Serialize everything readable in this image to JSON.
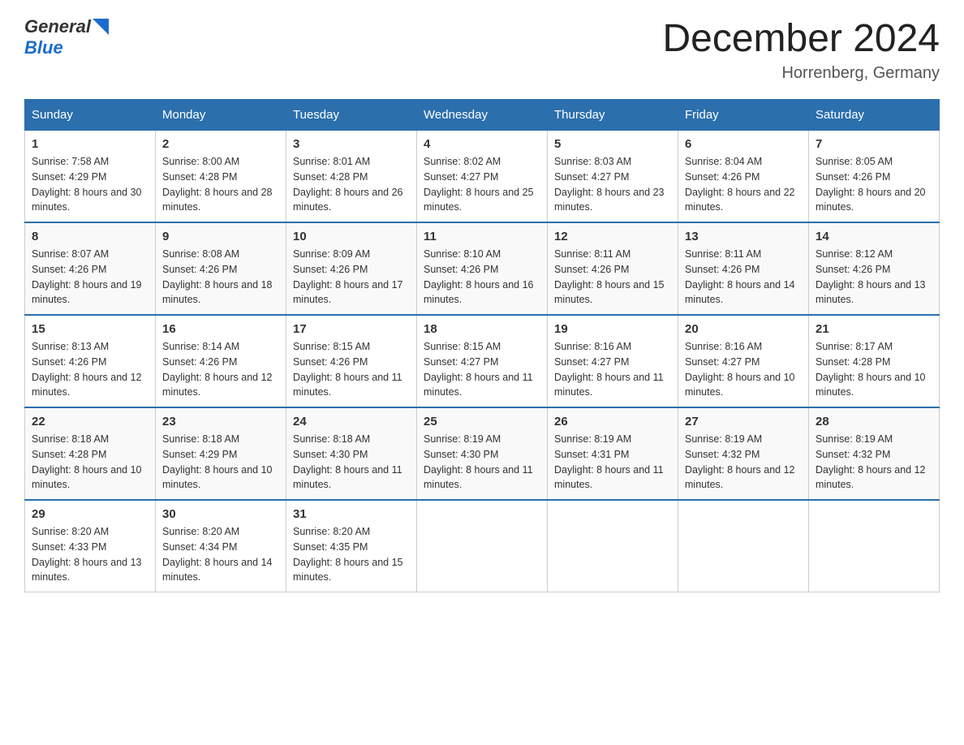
{
  "logo": {
    "general": "General",
    "blue": "Blue"
  },
  "title": "December 2024",
  "location": "Horrenberg, Germany",
  "days_header": [
    "Sunday",
    "Monday",
    "Tuesday",
    "Wednesday",
    "Thursday",
    "Friday",
    "Saturday"
  ],
  "weeks": [
    [
      {
        "day": "1",
        "sunrise": "7:58 AM",
        "sunset": "4:29 PM",
        "daylight": "8 hours and 30 minutes."
      },
      {
        "day": "2",
        "sunrise": "8:00 AM",
        "sunset": "4:28 PM",
        "daylight": "8 hours and 28 minutes."
      },
      {
        "day": "3",
        "sunrise": "8:01 AM",
        "sunset": "4:28 PM",
        "daylight": "8 hours and 26 minutes."
      },
      {
        "day": "4",
        "sunrise": "8:02 AM",
        "sunset": "4:27 PM",
        "daylight": "8 hours and 25 minutes."
      },
      {
        "day": "5",
        "sunrise": "8:03 AM",
        "sunset": "4:27 PM",
        "daylight": "8 hours and 23 minutes."
      },
      {
        "day": "6",
        "sunrise": "8:04 AM",
        "sunset": "4:26 PM",
        "daylight": "8 hours and 22 minutes."
      },
      {
        "day": "7",
        "sunrise": "8:05 AM",
        "sunset": "4:26 PM",
        "daylight": "8 hours and 20 minutes."
      }
    ],
    [
      {
        "day": "8",
        "sunrise": "8:07 AM",
        "sunset": "4:26 PM",
        "daylight": "8 hours and 19 minutes."
      },
      {
        "day": "9",
        "sunrise": "8:08 AM",
        "sunset": "4:26 PM",
        "daylight": "8 hours and 18 minutes."
      },
      {
        "day": "10",
        "sunrise": "8:09 AM",
        "sunset": "4:26 PM",
        "daylight": "8 hours and 17 minutes."
      },
      {
        "day": "11",
        "sunrise": "8:10 AM",
        "sunset": "4:26 PM",
        "daylight": "8 hours and 16 minutes."
      },
      {
        "day": "12",
        "sunrise": "8:11 AM",
        "sunset": "4:26 PM",
        "daylight": "8 hours and 15 minutes."
      },
      {
        "day": "13",
        "sunrise": "8:11 AM",
        "sunset": "4:26 PM",
        "daylight": "8 hours and 14 minutes."
      },
      {
        "day": "14",
        "sunrise": "8:12 AM",
        "sunset": "4:26 PM",
        "daylight": "8 hours and 13 minutes."
      }
    ],
    [
      {
        "day": "15",
        "sunrise": "8:13 AM",
        "sunset": "4:26 PM",
        "daylight": "8 hours and 12 minutes."
      },
      {
        "day": "16",
        "sunrise": "8:14 AM",
        "sunset": "4:26 PM",
        "daylight": "8 hours and 12 minutes."
      },
      {
        "day": "17",
        "sunrise": "8:15 AM",
        "sunset": "4:26 PM",
        "daylight": "8 hours and 11 minutes."
      },
      {
        "day": "18",
        "sunrise": "8:15 AM",
        "sunset": "4:27 PM",
        "daylight": "8 hours and 11 minutes."
      },
      {
        "day": "19",
        "sunrise": "8:16 AM",
        "sunset": "4:27 PM",
        "daylight": "8 hours and 11 minutes."
      },
      {
        "day": "20",
        "sunrise": "8:16 AM",
        "sunset": "4:27 PM",
        "daylight": "8 hours and 10 minutes."
      },
      {
        "day": "21",
        "sunrise": "8:17 AM",
        "sunset": "4:28 PM",
        "daylight": "8 hours and 10 minutes."
      }
    ],
    [
      {
        "day": "22",
        "sunrise": "8:18 AM",
        "sunset": "4:28 PM",
        "daylight": "8 hours and 10 minutes."
      },
      {
        "day": "23",
        "sunrise": "8:18 AM",
        "sunset": "4:29 PM",
        "daylight": "8 hours and 10 minutes."
      },
      {
        "day": "24",
        "sunrise": "8:18 AM",
        "sunset": "4:30 PM",
        "daylight": "8 hours and 11 minutes."
      },
      {
        "day": "25",
        "sunrise": "8:19 AM",
        "sunset": "4:30 PM",
        "daylight": "8 hours and 11 minutes."
      },
      {
        "day": "26",
        "sunrise": "8:19 AM",
        "sunset": "4:31 PM",
        "daylight": "8 hours and 11 minutes."
      },
      {
        "day": "27",
        "sunrise": "8:19 AM",
        "sunset": "4:32 PM",
        "daylight": "8 hours and 12 minutes."
      },
      {
        "day": "28",
        "sunrise": "8:19 AM",
        "sunset": "4:32 PM",
        "daylight": "8 hours and 12 minutes."
      }
    ],
    [
      {
        "day": "29",
        "sunrise": "8:20 AM",
        "sunset": "4:33 PM",
        "daylight": "8 hours and 13 minutes."
      },
      {
        "day": "30",
        "sunrise": "8:20 AM",
        "sunset": "4:34 PM",
        "daylight": "8 hours and 14 minutes."
      },
      {
        "day": "31",
        "sunrise": "8:20 AM",
        "sunset": "4:35 PM",
        "daylight": "8 hours and 15 minutes."
      },
      null,
      null,
      null,
      null
    ]
  ]
}
